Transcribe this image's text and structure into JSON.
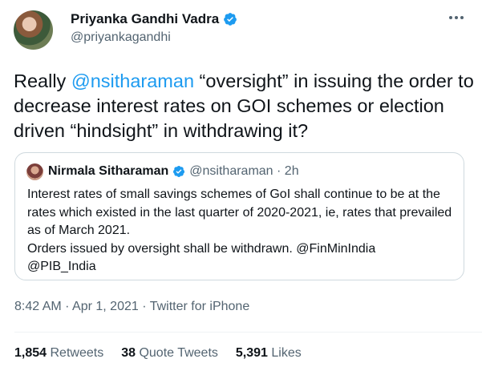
{
  "author": {
    "name": "Priyanka Gandhi Vadra",
    "handle": "@priyankagandhi"
  },
  "tweet": {
    "text_before": "Really ",
    "mention": "@nsitharaman",
    "text_after": " “oversight” in issuing the order to decrease interest rates on GOI schemes or election driven “hindsight” in withdrawing it?"
  },
  "quoted": {
    "name": "Nirmala Sitharaman",
    "handle": "@nsitharaman",
    "separator": " · ",
    "time": "2h",
    "line1": "Interest rates of small savings schemes of GoI shall continue to be at the rates which existed in the last quarter of 2020-2021, ie, rates that prevailed as of March 2021.",
    "line2_text": "Orders issued by oversight shall be withdrawn. ",
    "mention1": "@FinMinIndia",
    "mention2": "@PIB_India"
  },
  "meta": {
    "time": "8:42 AM",
    "sep": " · ",
    "date": "Apr 1, 2021",
    "source": "Twitter for iPhone"
  },
  "stats": {
    "retweets_count": "1,854",
    "retweets_label": "Retweets",
    "quotes_count": "38",
    "quotes_label": "Quote Tweets",
    "likes_count": "5,391",
    "likes_label": "Likes"
  },
  "colors": {
    "accent": "#1d9bf0",
    "text": "#0f1419",
    "secondary": "#536471"
  },
  "icons": {
    "verified": "verified-badge-icon",
    "more": "more-options-icon"
  }
}
